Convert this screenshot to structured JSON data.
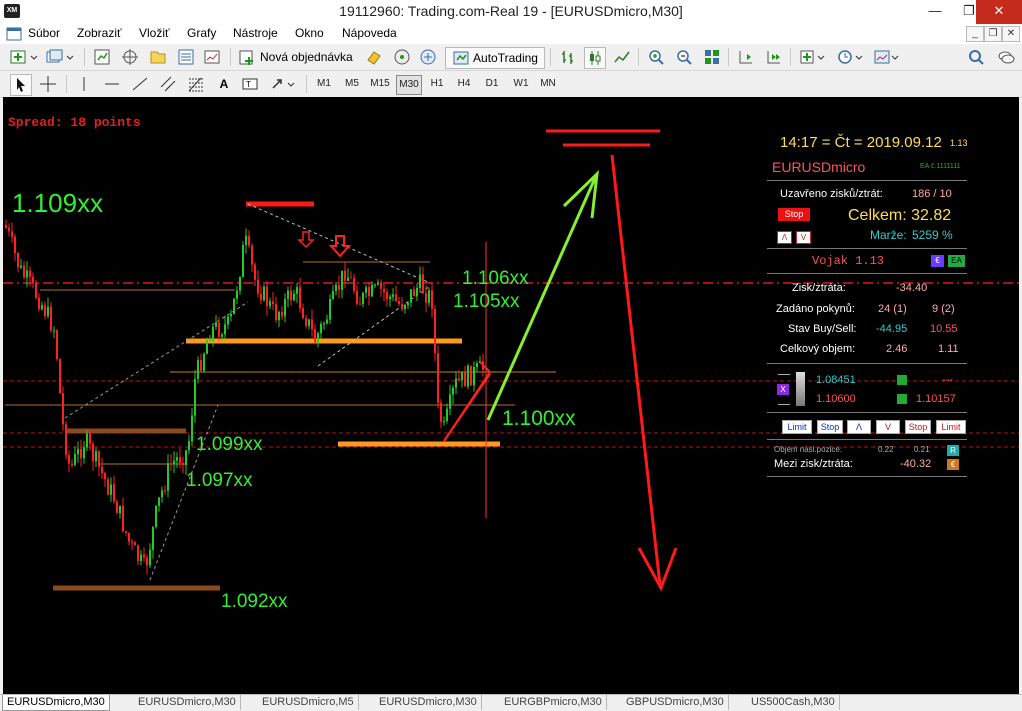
{
  "window": {
    "app_icon": "XM",
    "title": "19112960: Trading.com-Real 19 - [EURUSDmicro,M30]",
    "min": "—",
    "max": "❐",
    "close": "✕"
  },
  "menu": [
    "Súbor",
    "Zobraziť",
    "Vložiť",
    "Grafy",
    "Nástroje",
    "Okno",
    "Nápoveda"
  ],
  "toolbar": {
    "new_order": "Nová objednávka",
    "autotrading": "AutoTrading"
  },
  "timeframes": [
    "M1",
    "M5",
    "M15",
    "M30",
    "H1",
    "H4",
    "D1",
    "W1",
    "MN"
  ],
  "active_timeframe": "M30",
  "chart": {
    "spread": "Spread: 18 points",
    "levels": {
      "l1109": "1.109xx",
      "l1106": "1.106xx",
      "l1105": "1.105xx",
      "l1100": "1.100xx",
      "l1099": "1.099xx",
      "l1097": "1.097xx",
      "l1092": "1.092xx"
    }
  },
  "panel": {
    "clock": "14:17 = Čt = 2019.09.12",
    "version": "1.13",
    "symbol": "EURUSDmicro",
    "ea_code": "EA č.1111111",
    "closed_label": "Uzavřeno zisků/ztrát:",
    "closed_value": "186 / 10",
    "stop": "Stop",
    "total": "Celkem: 32.82",
    "margin_label": "Marže:",
    "margin_value": "5259 %",
    "up": "Λ",
    "down": "V",
    "ea_name": "Vojak 1.13",
    "euro_badge": "€",
    "ea_badge": "EA",
    "pl_label": "Zisk/ztráta:",
    "pl_value": "-34.40",
    "orders_label": "Zadáno pokynů:",
    "orders_buy": "24 (1)",
    "orders_sell": "9 (2)",
    "state_label": "Stav Buy/Sell:",
    "state_buy": "-44.95",
    "state_sell": "10.55",
    "volume_label": "Celkový objem:",
    "volume_buy": "2.46",
    "volume_sell": "1.11",
    "x_badge": "X",
    "price_low": "1.08451",
    "price_high": "1.10600",
    "price_dash": "---",
    "price_right": "1.10157",
    "buttons": [
      "Limit",
      "Stop",
      "Λ",
      "V",
      "Stop",
      "Limit"
    ],
    "next_pos_label": "Objem násl.pozice:",
    "next_buy": "0.22",
    "next_sell": "0.21",
    "r_badge": "R",
    "interim_label": "Mezi zisk/ztráta:",
    "interim_value": "-40.32",
    "interim_badge": "€"
  },
  "tabs": [
    "EURUSDmicro,M30",
    "EURUSDmicro,M30",
    "EURUSDmicro,M5",
    "EURUSDmicro,M30",
    "EURGBPmicro,M30",
    "GBPUSDmicro,M30",
    "US500Cash,M30"
  ],
  "colors": {
    "chart_bg": "#000000",
    "bull": "#22cc22",
    "bear": "#ff2020",
    "level_text": "#33ee33",
    "orange": "#ff9a1f",
    "brown": "#8b4a1d",
    "close_btn": "#c42b1c",
    "panel_gold": "#ffdd55",
    "panel_cyan": "#33cccc"
  }
}
